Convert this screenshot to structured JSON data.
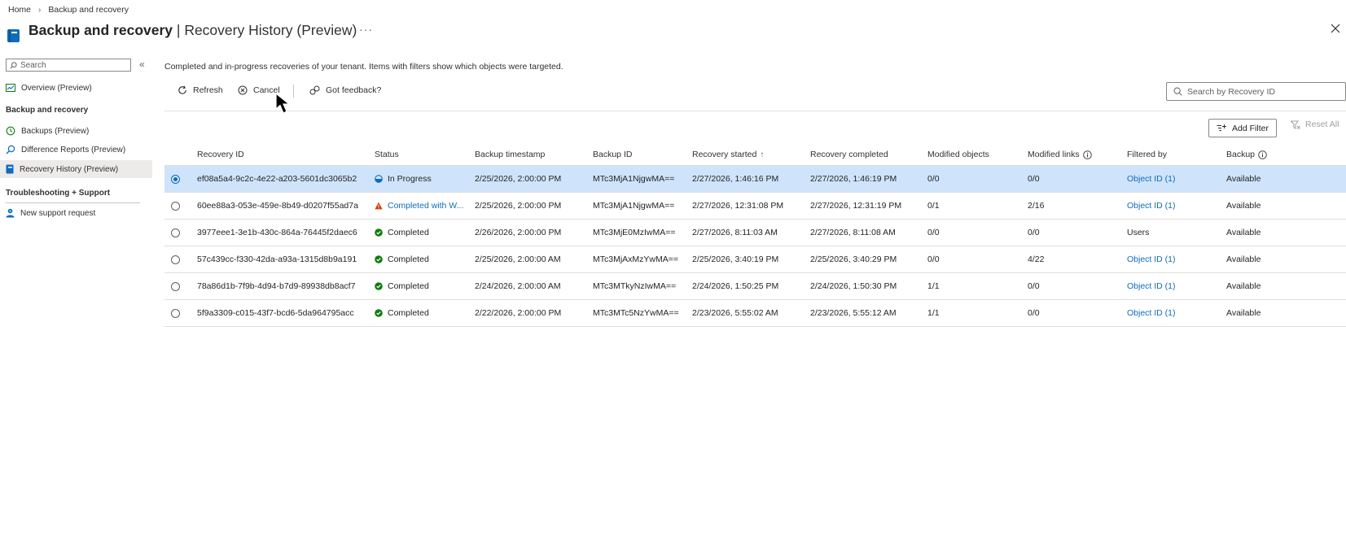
{
  "breadcrumb": {
    "home": "Home",
    "current": "Backup and recovery"
  },
  "header": {
    "title": "Backup and recovery",
    "subtitle": "| Recovery History (Preview)",
    "more": "···"
  },
  "sidebar": {
    "search_placeholder": "Search",
    "items": [
      {
        "label": "Overview (Preview)",
        "icon": "overview-icon"
      },
      {
        "label": "Backups (Preview)",
        "icon": "history-icon"
      },
      {
        "label": "Difference Reports (Preview)",
        "icon": "search-report-icon"
      },
      {
        "label": "Recovery History (Preview)",
        "icon": "book-icon",
        "active": true
      },
      {
        "label": "New support request",
        "icon": "person-support-icon"
      }
    ],
    "section_backup": "Backup and recovery",
    "section_support": "Troubleshooting + Support"
  },
  "main": {
    "description": "Completed and in-progress recoveries of your tenant. Items with filters show which objects were targeted.",
    "toolbar": {
      "refresh": "Refresh",
      "cancel": "Cancel",
      "feedback": "Got feedback?"
    },
    "search_placeholder": "Search by Recovery ID",
    "add_filter": "Add Filter",
    "reset_all": "Reset All"
  },
  "table": {
    "columns": [
      "Recovery ID",
      "Status",
      "Backup timestamp",
      "Backup ID",
      "Recovery started",
      "Recovery completed",
      "Modified objects",
      "Modified links",
      "Filtered by",
      "Backup"
    ],
    "sort_indicator": "↑",
    "rows": [
      {
        "id": "ef08a5a4-9c2c-4e22-a203-5601dc3065b2",
        "status": "In Progress",
        "status_kind": "progress",
        "backup_ts": "2/25/2026, 2:00:00 PM",
        "backup_id": "MTc3MjA1NjgwMA==",
        "started": "2/27/2026, 1:46:16 PM",
        "completed": "2/27/2026, 1:46:19 PM",
        "mod_objects": "0/0",
        "mod_links": "0/0",
        "filtered_by": "Object ID (1)",
        "filtered_link": true,
        "backup": "Available",
        "selected": true
      },
      {
        "id": "60ee88a3-053e-459e-8b49-d0207f55ad7a",
        "status": "Completed with W...",
        "status_kind": "warning",
        "backup_ts": "2/25/2026, 2:00:00 PM",
        "backup_id": "MTc3MjA1NjgwMA==",
        "started": "2/27/2026, 12:31:08 PM",
        "completed": "2/27/2026, 12:31:19 PM",
        "mod_objects": "0/1",
        "mod_links": "2/16",
        "filtered_by": "Object ID (1)",
        "filtered_link": true,
        "backup": "Available",
        "selected": false
      },
      {
        "id": "3977eee1-3e1b-430c-864a-76445f2daec6",
        "status": "Completed",
        "status_kind": "completed",
        "backup_ts": "2/26/2026, 2:00:00 PM",
        "backup_id": "MTc3MjE0MzIwMA==",
        "started": "2/27/2026, 8:11:03 AM",
        "completed": "2/27/2026, 8:11:08 AM",
        "mod_objects": "0/0",
        "mod_links": "0/0",
        "filtered_by": "Users",
        "filtered_link": false,
        "backup": "Available",
        "selected": false
      },
      {
        "id": "57c439cc-f330-42da-a93a-1315d8b9a191",
        "status": "Completed",
        "status_kind": "completed",
        "backup_ts": "2/25/2026, 2:00:00 AM",
        "backup_id": "MTc3MjAxMzYwMA==",
        "started": "2/25/2026, 3:40:19 PM",
        "completed": "2/25/2026, 3:40:29 PM",
        "mod_objects": "0/0",
        "mod_links": "4/22",
        "filtered_by": "Object ID (1)",
        "filtered_link": true,
        "backup": "Available",
        "selected": false
      },
      {
        "id": "78a86d1b-7f9b-4d94-b7d9-89938db8acf7",
        "status": "Completed",
        "status_kind": "completed",
        "backup_ts": "2/24/2026, 2:00:00 AM",
        "backup_id": "MTc3MTkyNzIwMA==",
        "started": "2/24/2026, 1:50:25 PM",
        "completed": "2/24/2026, 1:50:30 PM",
        "mod_objects": "1/1",
        "mod_links": "0/0",
        "filtered_by": "Object ID (1)",
        "filtered_link": true,
        "backup": "Available",
        "selected": false
      },
      {
        "id": "5f9a3309-c015-43f7-bcd6-5da964795acc",
        "status": "Completed",
        "status_kind": "completed",
        "backup_ts": "2/22/2026, 2:00:00 PM",
        "backup_id": "MTc3MTc5NzYwMA==",
        "started": "2/23/2026, 5:55:02 AM",
        "completed": "2/23/2026, 5:55:12 AM",
        "mod_objects": "1/1",
        "mod_links": "0/0",
        "filtered_by": "Object ID (1)",
        "filtered_link": true,
        "backup": "Available",
        "selected": false
      }
    ]
  },
  "colors": {
    "accent": "#0f6cbd",
    "selected_row": "#cfe4fa",
    "success": "#107c10",
    "warning": "#d83b01",
    "nav_active": "#edebe9"
  }
}
